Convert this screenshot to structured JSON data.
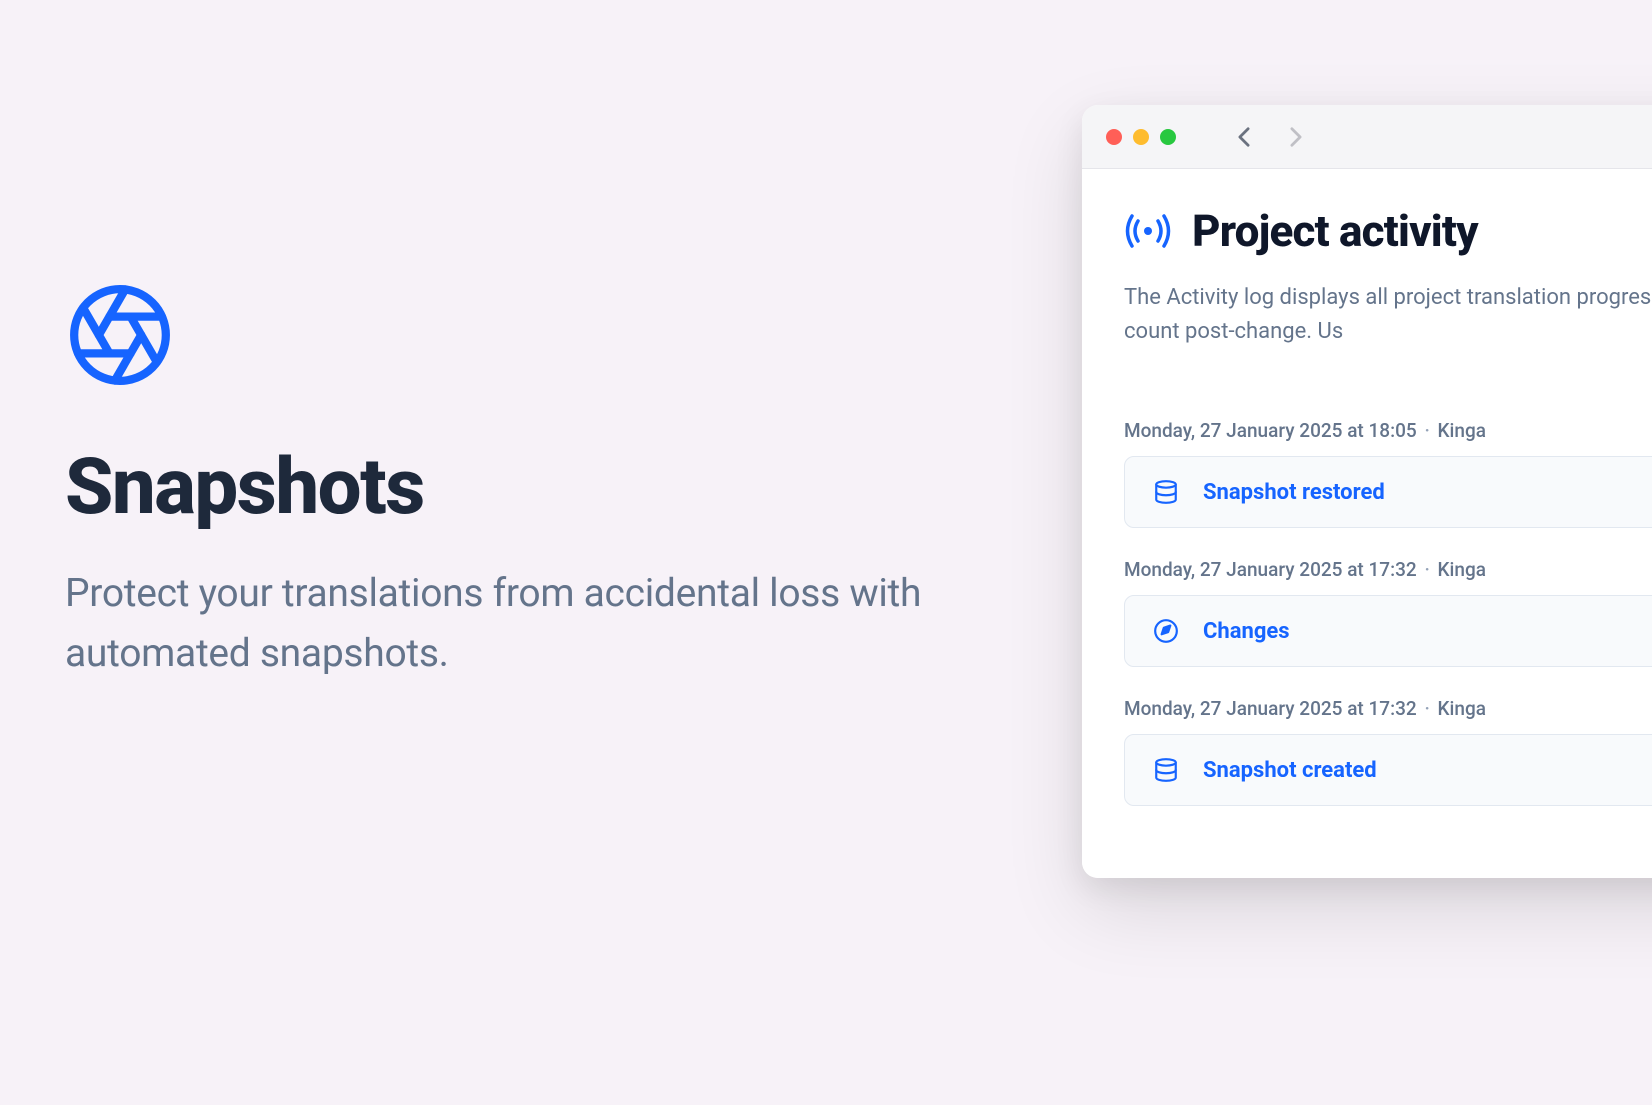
{
  "hero": {
    "title": "Snapshots",
    "subtitle": "Protect your translations from accidental loss with automated snapshots."
  },
  "window": {
    "activity_title": "Project activity",
    "activity_description": "The Activity log displays all project translation progress and key count post-change. Us",
    "items": [
      {
        "timestamp": "Monday, 27 January 2025 at 18:05",
        "author": "Kinga",
        "label": "Snapshot restored",
        "icon": "database"
      },
      {
        "timestamp": "Monday, 27 January 2025 at 17:32",
        "author": "Kinga",
        "label": "Changes",
        "icon": "edit"
      },
      {
        "timestamp": "Monday, 27 January 2025 at 17:32",
        "author": "Kinga",
        "label": "Snapshot created",
        "icon": "database"
      }
    ]
  },
  "colors": {
    "accent": "#1664ff",
    "text_dark": "#1e293b",
    "text_muted": "#64748b",
    "bg": "#f7f2f8"
  }
}
